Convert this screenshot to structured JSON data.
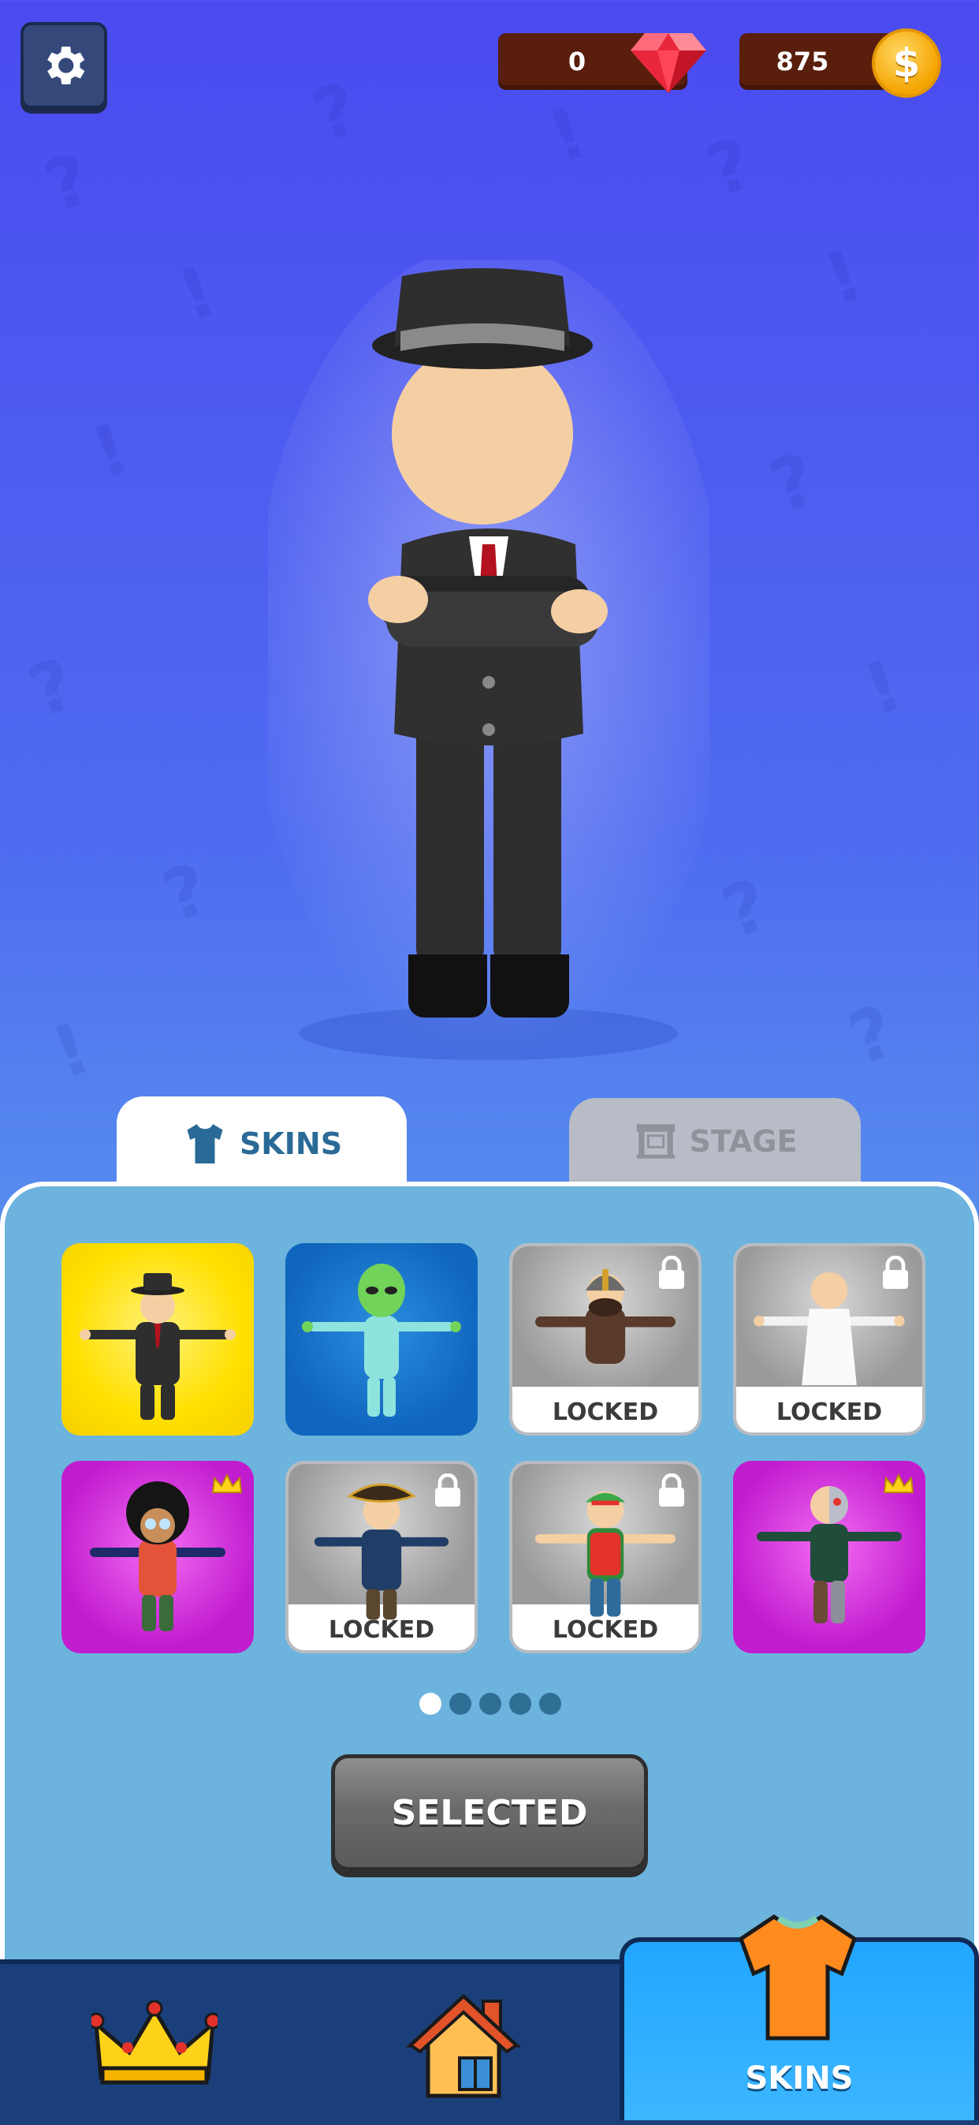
{
  "header": {
    "settings_icon": "gear-icon",
    "gems": {
      "value": "0",
      "icon": "gem-icon"
    },
    "coins": {
      "value": "875",
      "icon": "coin-icon"
    }
  },
  "preview": {
    "character": "mafia-boss"
  },
  "tabs": [
    {
      "label": "SKINS",
      "icon": "shirt-icon",
      "active": true
    },
    {
      "label": "STAGE",
      "icon": "stage-icon",
      "active": false
    }
  ],
  "skins": [
    {
      "name": "mafia",
      "bg": "yellow",
      "locked": false,
      "premium": false
    },
    {
      "name": "alien",
      "bg": "blue",
      "locked": false,
      "premium": false
    },
    {
      "name": "viking",
      "bg": "gray",
      "locked": true,
      "premium": false,
      "label": "LOCKED"
    },
    {
      "name": "robe",
      "bg": "gray",
      "locked": true,
      "premium": false,
      "label": "LOCKED"
    },
    {
      "name": "afro",
      "bg": "magenta",
      "locked": false,
      "premium": true
    },
    {
      "name": "pirate",
      "bg": "gray",
      "locked": true,
      "premium": false,
      "label": "LOCKED"
    },
    {
      "name": "elf",
      "bg": "gray",
      "locked": true,
      "premium": false,
      "label": "LOCKED"
    },
    {
      "name": "cyborg",
      "bg": "magenta",
      "locked": false,
      "premium": true
    }
  ],
  "pagination": {
    "pages": 5,
    "current": 1
  },
  "action_button": {
    "label": "SELECTED"
  },
  "bottom_nav": [
    {
      "name": "leaderboard",
      "icon": "crown-icon"
    },
    {
      "name": "home",
      "icon": "house-icon"
    },
    {
      "name": "skins",
      "icon": "shirt-icon",
      "label": "SKINS",
      "active": true
    }
  ],
  "colors": {
    "accent_blue": "#2a6a96",
    "gem": "#e8283a",
    "coin": "#f4a400",
    "nav_active": "#22a6ff",
    "shirt_orange": "#ff8a1e"
  }
}
